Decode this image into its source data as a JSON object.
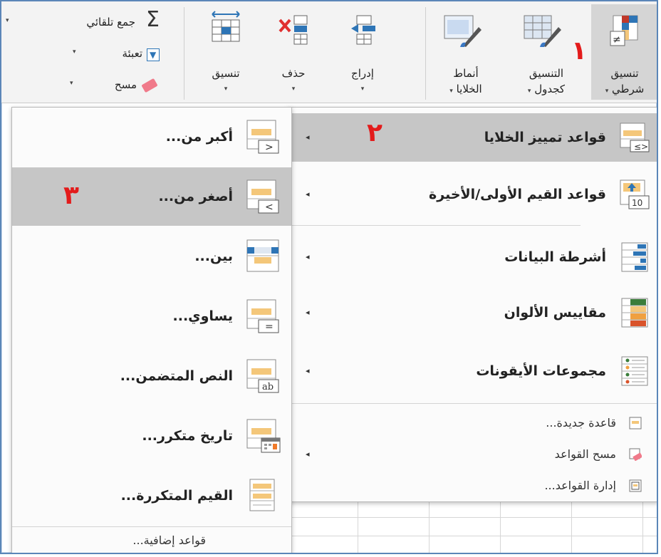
{
  "ribbon": {
    "conditional_formatting": {
      "line1": "تنسيق",
      "line2": "شرطي",
      "caret": "▾"
    },
    "format_as_table": {
      "line1": "التنسيق",
      "line2": "كجدول",
      "caret": "▾"
    },
    "cell_styles": {
      "line1": "أنماط",
      "line2": "الخلايا",
      "caret": "▾"
    },
    "insert": {
      "label": "إدراج",
      "caret": "▾"
    },
    "delete": {
      "label": "حذف",
      "caret": "▾"
    },
    "format": {
      "label": "تنسيق",
      "caret": "▾"
    },
    "autosum": {
      "label": "جمع تلقائي",
      "symbol": "Σ",
      "caret": "▾"
    },
    "fill": {
      "label": "تعبئة",
      "caret": "▾"
    },
    "clear": {
      "label": "مسح",
      "caret": "▾"
    }
  },
  "annotations": {
    "step1": "١",
    "step2": "٢",
    "step3": "٣",
    "color": "#e31b1b"
  },
  "main_menu": {
    "items": [
      {
        "label": "قواعد تمييز الخلايا",
        "arrow": "◂",
        "icon": "highlight-cells-rules-icon"
      },
      {
        "label": "قواعد القيم الأولى/الأخيرة",
        "arrow": "◂",
        "icon": "top-bottom-rules-icon"
      },
      {
        "label": "أشرطة البيانات",
        "arrow": "◂",
        "icon": "data-bars-icon"
      },
      {
        "label": "مقاييس الألوان",
        "arrow": "◂",
        "icon": "color-scales-icon"
      },
      {
        "label": "مجموعات الأيقونات",
        "arrow": "◂",
        "icon": "icon-sets-icon"
      }
    ],
    "small_items": [
      {
        "label": "قاعدة جديدة...",
        "icon": "new-rule-icon"
      },
      {
        "label": "مسح القواعد",
        "icon": "clear-rules-icon"
      },
      {
        "label": "إدارة القواعد...",
        "icon": "manage-rules-icon"
      }
    ],
    "clear_arrow": "◂"
  },
  "sub_menu": {
    "items": [
      {
        "label": "أكبر من...",
        "icon": "greater-than-icon",
        "glyph": ">"
      },
      {
        "label": "أصغر من...",
        "icon": "less-than-icon",
        "glyph": "<"
      },
      {
        "label": "بين...",
        "icon": "between-icon"
      },
      {
        "label": "يساوي...",
        "icon": "equal-to-icon",
        "glyph": "="
      },
      {
        "label": "النص المتضمن...",
        "icon": "text-contains-icon",
        "glyph": "ab"
      },
      {
        "label": "تاريخ متكرر...",
        "icon": "date-occurring-icon"
      },
      {
        "label": "القيم المتكررة...",
        "icon": "duplicate-values-icon"
      }
    ],
    "more_rules": "قواعد إضافية...",
    "more_rules_icon_glyph": "≤",
    "top_bottom_icon_glyph": "10"
  },
  "colors": {
    "selected_bg": "#c6c6c6",
    "accent_blue": "#2e75b6",
    "cell_yellow": "#f4c77a"
  }
}
